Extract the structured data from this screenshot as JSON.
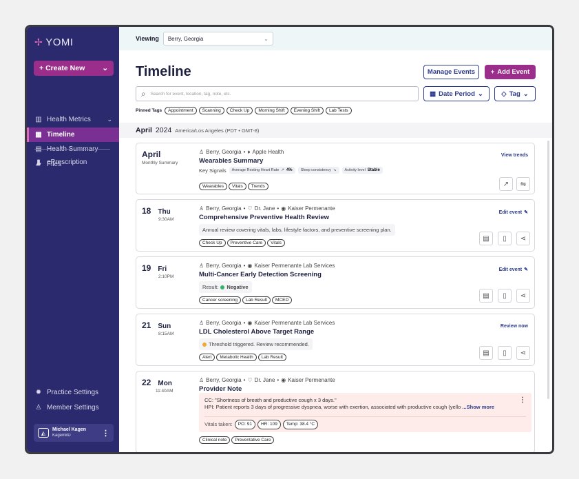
{
  "app": {
    "name": "YOMI"
  },
  "sidebar": {
    "create_label": "Create New",
    "items": [
      {
        "label": "Health Metrics",
        "icon": "bar-chart-icon"
      },
      {
        "label": "Timeline",
        "icon": "calendar-icon"
      },
      {
        "label": "Health Summary",
        "icon": "summary-card-icon"
      },
      {
        "label": "Files",
        "icon": "folder-icon"
      },
      {
        "label": "ePrescription",
        "icon": "prescription-icon"
      }
    ],
    "bottom": [
      {
        "label": "Practice Settings",
        "icon": "gear-icon"
      },
      {
        "label": "Member Settings",
        "icon": "user-icon"
      }
    ],
    "user": {
      "name": "Michael Kagen",
      "org": "KagenMD"
    }
  },
  "header": {
    "viewing_label": "Viewing",
    "viewing_value": "Berry, Georgia"
  },
  "page": {
    "title": "Timeline",
    "manage_label": "Manage Events",
    "add_label": "Add Event",
    "search_placeholder": "Search for event, location, tag, note, etc.",
    "date_period_label": "Date Period",
    "tag_label": "Tag",
    "pinned_label": "Pinned Tags",
    "pinned_tags": [
      "Appointment",
      "Scanning",
      "Check Up",
      "Morning Shift",
      "Evening Shift",
      "Lab Tests"
    ],
    "month": "April",
    "year": "2024",
    "timezone": "America/Los Angeles (PDT • GMT-8)"
  },
  "cards": {
    "summary": {
      "title": "April",
      "subtitle": "Monthly Summary",
      "patient": "Berry, Georgia",
      "source": "Apple Health",
      "event": "Wearables Summary",
      "key_signals_label": "Key Signals",
      "signals": [
        {
          "label": "Average Resting Heart Rate",
          "value": "4%"
        },
        {
          "label": "Sleep consistency",
          "value": ""
        },
        {
          "label": "Activity level",
          "value": "Stable"
        }
      ],
      "tags": [
        "Wearables",
        "Vitals",
        "Trends"
      ],
      "link": "View trends"
    },
    "c18": {
      "day": "18",
      "weekday": "Thu",
      "time": "9:30AM",
      "patient": "Berry, Georgia",
      "provider": "Dr. Jane",
      "location": "Kaiser Permenante",
      "title": "Comprehensive Preventive Health Review",
      "desc": "Annual review covering vitals, labs, lifestyle factors, and preventive screening plan.",
      "tags": [
        "Check Up",
        "Preventive Care",
        "Vitals"
      ],
      "link": "Edit event"
    },
    "c19": {
      "day": "19",
      "weekday": "Fri",
      "time": "2:10PM",
      "patient": "Berry, Georgia",
      "location": "Kaiser Permenante Lab Services",
      "title": "Multi-Cancer Early Detection Screening",
      "result_label": "Result:",
      "result_value": "Negative",
      "tags": [
        "Cancer screening",
        "Lab Result",
        "MCED"
      ],
      "link": "Edit event"
    },
    "c21": {
      "day": "21",
      "weekday": "Sun",
      "time": "8:15AM",
      "patient": "Berry, Georgia",
      "location": "Kaiser Permenante Lab Services",
      "title": "LDL Cholesterol Above Target Range",
      "desc": "Threshold triggered. Review recommended.",
      "tags": [
        "Alert",
        "Metabolic Health",
        "Lab Result"
      ],
      "link": "Review now"
    },
    "c22": {
      "day": "22",
      "weekday": "Mon",
      "time": "11:40AM",
      "patient": "Berry, Georgia",
      "provider": "Dr. Jane",
      "location": "Kaiser Permenante",
      "title": "Provider Note",
      "cc": "CC: \"Shortness of breath and productive cough x 3 days.\"",
      "hpi": "HPI: Patient reports 3 days of progressive dyspnea, worse with exertion, associated with productive cough (yello",
      "show_more": "...Show more",
      "vitals_label": "Vitals taken:",
      "vitals": [
        "PO: 91",
        "HR: 109",
        "Temp: 38.4 °C"
      ],
      "tags": [
        "Clinical note",
        "Preventative Care"
      ]
    }
  },
  "colors": {
    "sidebar": "#2b2a6e",
    "accent": "#9a2e8a",
    "primary": "#2b3a8c"
  }
}
